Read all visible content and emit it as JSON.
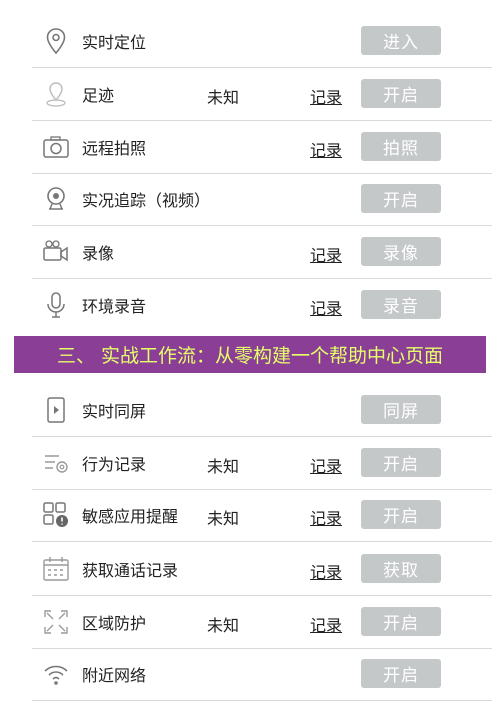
{
  "rows_top": [
    {
      "label": "实时定位",
      "status": "",
      "record": "",
      "button": "进入",
      "icon": "location-pin-icon"
    },
    {
      "label": "足迹",
      "status": "未知",
      "record": "记录",
      "button": "开启",
      "icon": "footprint-icon"
    },
    {
      "label": "远程拍照",
      "status": "",
      "record": "记录",
      "button": "拍照",
      "icon": "camera-icon"
    },
    {
      "label": "实况追踪（视频）",
      "status": "",
      "record": "",
      "button": "开启",
      "icon": "webcam-icon"
    },
    {
      "label": "录像",
      "status": "",
      "record": "记录",
      "button": "录像",
      "icon": "video-camera-icon"
    },
    {
      "label": "环境录音",
      "status": "",
      "record": "记录",
      "button": "录音",
      "icon": "microphone-icon"
    }
  ],
  "banner": {
    "text": "三、 实战工作流：从零构建一个帮助中心页面"
  },
  "rows_bottom": [
    {
      "label": "实时同屏",
      "status": "",
      "record": "",
      "button": "同屏",
      "icon": "phone-screen-icon"
    },
    {
      "label": "行为记录",
      "status": "未知",
      "record": "记录",
      "button": "开启",
      "icon": "behavior-log-icon"
    },
    {
      "label": "敏感应用提醒",
      "status": "未知",
      "record": "记录",
      "button": "开启",
      "icon": "app-alert-icon"
    },
    {
      "label": "获取通话记录",
      "status": "",
      "record": "记录",
      "button": "获取",
      "icon": "calendar-call-log-icon"
    },
    {
      "label": "区域防护",
      "status": "未知",
      "record": "记录",
      "button": "开启",
      "icon": "area-protect-icon"
    },
    {
      "label": "附近网络",
      "status": "",
      "record": "",
      "button": "开启",
      "icon": "wifi-icon"
    }
  ],
  "colors": {
    "button_bg": "#c4c8c9",
    "banner_bg": "#8b3e95",
    "banner_text": "#e5ff6a",
    "divider": "#d9d9d9"
  }
}
